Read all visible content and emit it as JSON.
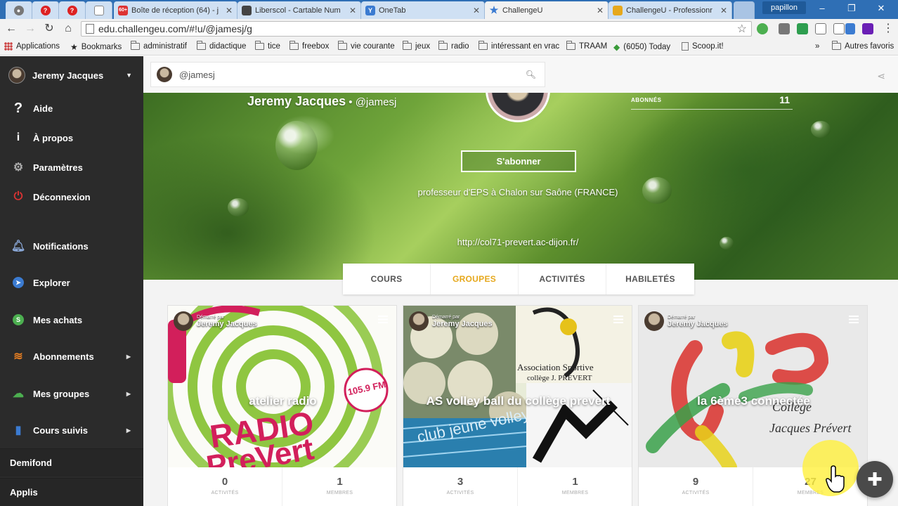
{
  "browser": {
    "tabs": [
      {
        "label": "",
        "icon": "chrome-icon"
      },
      {
        "label": "",
        "icon": "help-icon"
      },
      {
        "label": "",
        "icon": "help-icon"
      },
      {
        "label": "",
        "icon": "page-icon"
      },
      {
        "label": "Boîte de réception (64) - j",
        "icon": "gmail-icon",
        "badge": "60+"
      },
      {
        "label": "Liberscol - Cartable Num",
        "icon": "liberscol-icon"
      },
      {
        "label": "OneTab",
        "icon": "onetab-icon"
      },
      {
        "label": "ChallengeU",
        "icon": "star-icon"
      },
      {
        "label": "ChallengeU - Professionr",
        "icon": "challengeu-icon"
      }
    ],
    "profile": "papillon",
    "url": "edu.challengeu.com/#!u/@jamesj/g",
    "bookmarks": [
      {
        "label": "Applications"
      },
      {
        "label": "Bookmarks"
      },
      {
        "label": "administratif"
      },
      {
        "label": "didactique"
      },
      {
        "label": "tice"
      },
      {
        "label": "freebox"
      },
      {
        "label": "vie courante"
      },
      {
        "label": "jeux"
      },
      {
        "label": "radio"
      },
      {
        "label": "intéressant en vrac"
      },
      {
        "label": "TRAAM"
      },
      {
        "label": "(6050) Today"
      },
      {
        "label": "Scoop.it!"
      },
      {
        "label": "Autres favoris"
      }
    ],
    "bookmarks_more": "»"
  },
  "sidebar": {
    "user": "Jeremy Jacques",
    "items": [
      {
        "label": "Aide",
        "icon": "question-icon"
      },
      {
        "label": "À propos",
        "icon": "info-icon"
      },
      {
        "label": "Paramètres",
        "icon": "gear-icon"
      },
      {
        "label": "Déconnexion",
        "icon": "logout-icon"
      },
      {
        "label": "Notifications",
        "icon": "bell-icon"
      },
      {
        "label": "Explorer",
        "icon": "compass-icon"
      },
      {
        "label": "Mes achats",
        "icon": "coin-icon",
        "icon_text": "S"
      },
      {
        "label": "Abonnements",
        "icon": "rss-icon"
      },
      {
        "label": "Mes groupes",
        "icon": "group-icon"
      },
      {
        "label": "Cours suivis",
        "icon": "book-icon"
      }
    ],
    "sections": [
      "Demifond",
      "Applis"
    ]
  },
  "search": {
    "value": "@jamesj"
  },
  "profile": {
    "name": "Jeremy Jacques",
    "separator": " • ",
    "handle": "@jamesj",
    "subscribers_label": "ABONNÉS",
    "subscribers_count": "11",
    "follow_label": "S'abonner",
    "bio": "professeur d'EPS à Chalon sur Saône (FRANCE)",
    "website": "http://col71-prevert.ac-dijon.fr/"
  },
  "tabs": [
    {
      "label": "COURS",
      "active": false
    },
    {
      "label": "GROUPES",
      "active": true
    },
    {
      "label": "ACTIVITÉS",
      "active": false
    },
    {
      "label": "HABILETÉS",
      "active": false
    }
  ],
  "groups": [
    {
      "title": "atelier radio",
      "started_by_label": "Démarré par",
      "owner": "Jeremy Jacques",
      "activities": "0",
      "members": "1",
      "activities_label": "ACTIVITÉS",
      "members_label": "MEMBRES",
      "logo_text": [
        "RADIO",
        "PreVert"
      ],
      "badge": "105.9 FM"
    },
    {
      "title": "AS volley ball du collège prevert",
      "started_by_label": "Démarré par",
      "owner": "Jeremy Jacques",
      "activities": "3",
      "members": "1",
      "activities_label": "ACTIVITÉS",
      "members_label": "MEMBRES",
      "logo_text": [
        "Association Sportive",
        "collège J. PREVERT",
        "club jeune volley"
      ]
    },
    {
      "title": "la 6ème3 connectée",
      "started_by_label": "Démarré par",
      "owner": "Jeremy Jacques",
      "activities": "9",
      "members": "27",
      "activities_label": "ACTIVITÉS",
      "members_label": "MEMBRES",
      "logo_text": [
        "Collège",
        "Jacques Prévert"
      ]
    }
  ],
  "colors": {
    "accent": "#e6a81c",
    "sidebar": "#2b2b2b",
    "tab_bar": "#2f6fb5"
  }
}
